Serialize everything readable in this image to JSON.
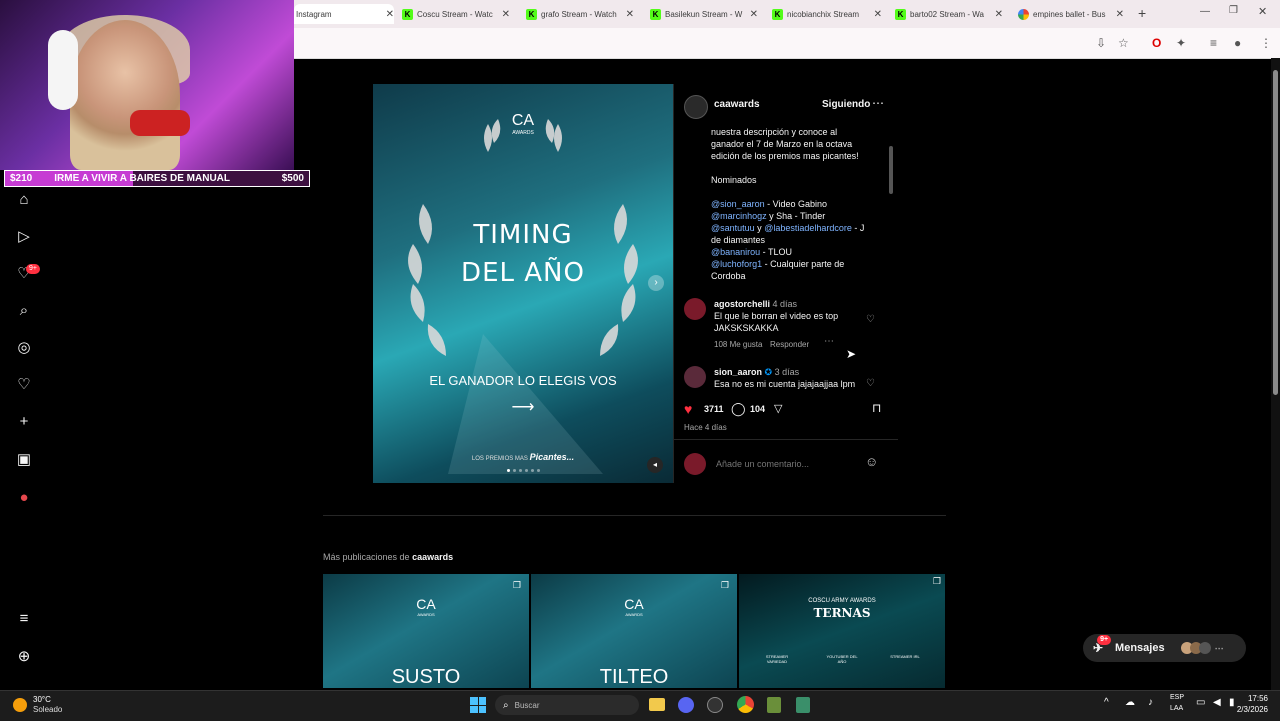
{
  "browser": {
    "tabs": [
      {
        "label": "Instagram",
        "active": true
      },
      {
        "label": "Coscu Stream - Watc"
      },
      {
        "label": "grafo Stream - Watch"
      },
      {
        "label": "Basilekun Stream - W"
      },
      {
        "label": "nicobianchix Stream"
      },
      {
        "label": "barto02 Stream - Wa"
      },
      {
        "label": "empines ballet - Bus"
      }
    ]
  },
  "overlay": {
    "goal_start": "$210",
    "goal_text": "IRME A VIVIR A BAIRES DE MANUAL",
    "goal_end": "$500",
    "goal_progress": 0.42
  },
  "nav": {
    "notifications_badge": "9+"
  },
  "post": {
    "logo_text": "CA",
    "logo_sub": "AWARDS",
    "headline_1": "TIMING",
    "headline_2": "DEL AÑO",
    "subline": "EL GANADOR LO ELEGIS VOS",
    "footer_small": "LOS PREMIOS MAS",
    "footer_script": "Picantes...",
    "slide_count": 6,
    "slide_active": 0
  },
  "panel": {
    "username": "caawards",
    "follow_label": "Siguiendo",
    "caption_lines": [
      "nuestra descripción y conoce al",
      "ganador el 7 de Marzo en la octava",
      "edición de los premios mas picantes!"
    ],
    "nominados_label": "Nominados",
    "nominees": [
      {
        "mention": "@sion_aaron",
        "rest": " - Video Gabino"
      },
      {
        "mention": "@marcinhogz",
        "rest": " y Sha - Tinder"
      },
      {
        "mention": "@santutuu",
        "rest": " y ",
        "mention2": "@labestiadelhardcore",
        "rest2": " - J"
      },
      {
        "mention": "",
        "rest": "de diamantes"
      },
      {
        "mention": "@bananirou",
        "rest": " - TLOU"
      },
      {
        "mention": "@luchoforg1",
        "rest": " - Cualquier parte de"
      },
      {
        "mention": "",
        "rest": "Cordoba"
      }
    ],
    "comments": [
      {
        "user": "agostorchelli",
        "time": "4 días",
        "text_1": "El que le borran el video es top",
        "text_2": "JAKSKSKAKKA",
        "likes": "108 Me gusta",
        "reply": "Responder"
      },
      {
        "user": "sion_aaron",
        "time": "3 días",
        "text_1": "Esa no es mi cuenta jajajaajjaa lpm",
        "verified": true
      }
    ],
    "likes_count": "3711",
    "comments_count": "104",
    "post_time": "Hace 4 días",
    "comment_placeholder": "Añade un comentario..."
  },
  "more_posts": {
    "label_prefix": "Más publicaciones de",
    "label_user": "caawards",
    "thumbs": [
      {
        "logo": "CA",
        "logo_sub": "AWARDS",
        "title": "SUSTO"
      },
      {
        "logo": "CA",
        "logo_sub": "AWARDS",
        "title": "TILTEO"
      },
      {
        "logo": "COSCU ARMY AWARDS",
        "title": "TERNAS",
        "labels": [
          "STREAMER VARIEDAD",
          "YOUTUBER DEL AÑO",
          "STREAMER IRL"
        ]
      }
    ]
  },
  "messages": {
    "label": "Mensajes",
    "badge": "9+"
  },
  "taskbar": {
    "weather_temp": "30°C",
    "weather_text": "Soleado",
    "search_placeholder": "Buscar",
    "lang_1": "ESP",
    "lang_2": "LAA",
    "time": "17:56",
    "date": "2/3/2026"
  },
  "colors": {
    "heart": "#ff3040",
    "mention": "#7fb4ff",
    "goal_fill": "#c63bd3"
  }
}
